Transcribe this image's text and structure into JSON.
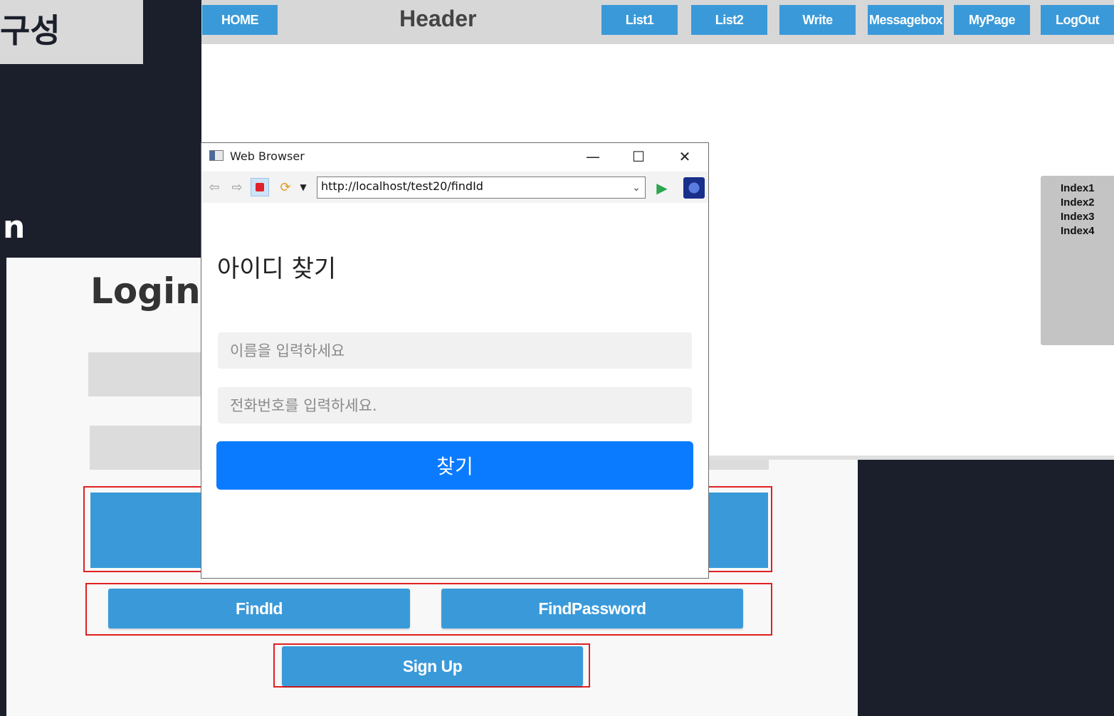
{
  "slide": {
    "title_fragment": "구성",
    "subtitle_fragment": "n"
  },
  "login_page": {
    "title": "Login",
    "find_id_label": "FindId",
    "find_password_label": "FindPassword",
    "signup_label": "Sign Up"
  },
  "header_page": {
    "home_label": "HOME",
    "title": "Header",
    "nav": [
      "List1",
      "List2",
      "Write",
      "Messagebox",
      "MyPage",
      "LogOut"
    ],
    "index_items": [
      "Index1",
      "Index2",
      "Index3",
      "Index4"
    ]
  },
  "browser": {
    "title": "Web Browser",
    "url": "http://localhost/test20/findId",
    "icons": {
      "back": "back-arrow-icon",
      "forward": "forward-arrow-icon",
      "stop": "stop-icon",
      "refresh": "refresh-icon",
      "go": "go-play-icon"
    }
  },
  "find_id_form": {
    "heading": "아이디 찾기",
    "name_placeholder": "이름을 입력하세요",
    "phone_placeholder": "전화번호를 입력하세요.",
    "submit_label": "찾기"
  },
  "colors": {
    "background": "#1b1f2b",
    "button_blue": "#3a9ad9",
    "find_button_blue": "#0a7bff",
    "highlight_red": "#e02020"
  }
}
